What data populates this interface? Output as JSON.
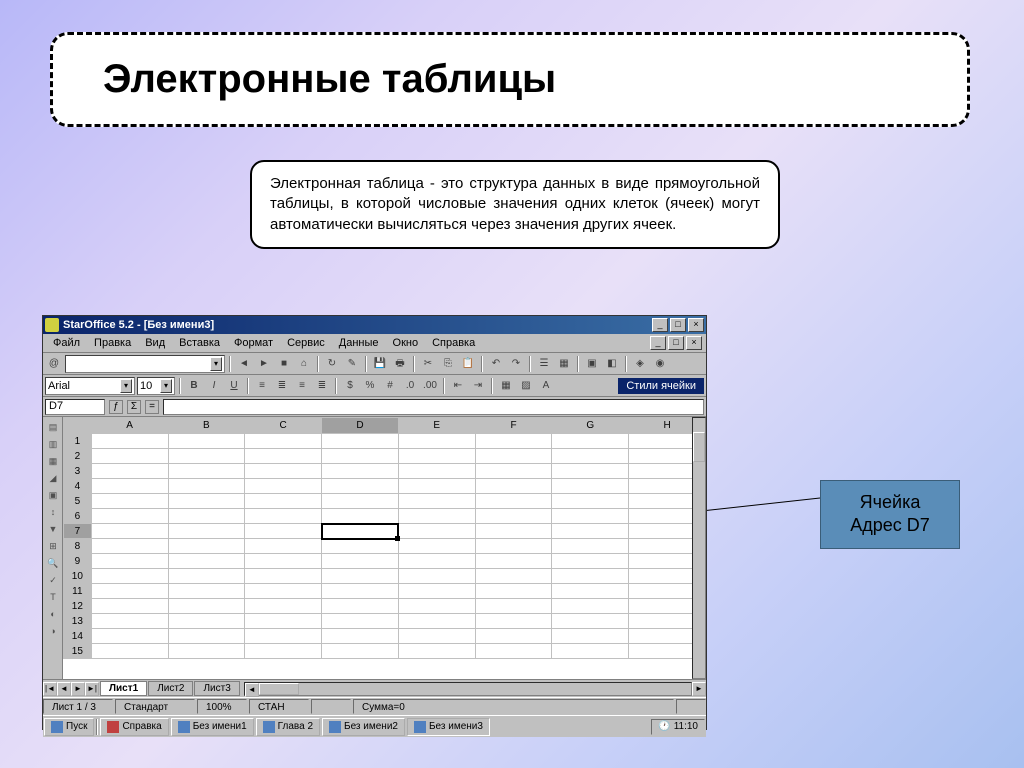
{
  "slide": {
    "title": "Электронные таблицы",
    "description": "Электронная таблица - это структура данных в виде прямоугольной таблицы, в которой числовые значения одних клеток (ячеек) могут автоматически вычисляться через значения других ячеек."
  },
  "callout": {
    "line1": "Ячейка",
    "line2": "Адрес D7"
  },
  "app": {
    "window_title": "StarOffice 5.2 - [Без имени3]",
    "win_buttons": {
      "min": "_",
      "max": "□",
      "close": "×"
    },
    "menu": [
      "Файл",
      "Правка",
      "Вид",
      "Вставка",
      "Формат",
      "Сервис",
      "Данные",
      "Окно",
      "Справка"
    ],
    "font_name": "Arial",
    "font_size": "10",
    "style_label": "Стили ячейки",
    "cell_ref": "D7",
    "columns": [
      "A",
      "B",
      "C",
      "D",
      "E",
      "F",
      "G",
      "H"
    ],
    "row_count": 15,
    "active_cell": {
      "row": 7,
      "col": "D"
    },
    "tabs": {
      "active": "Лист1",
      "others": [
        "Лист2",
        "Лист3"
      ]
    },
    "status": {
      "sheet": "Лист 1 / 3",
      "mode": "Стандарт",
      "zoom": "100%",
      "stan": "СТАН",
      "sum": "Сумма=0"
    },
    "taskbar": {
      "start": "Пуск",
      "items": [
        "Справка",
        "Без имени1",
        "Глава 2",
        "Без имени2",
        "Без имени3"
      ],
      "clock": "11:10"
    }
  }
}
